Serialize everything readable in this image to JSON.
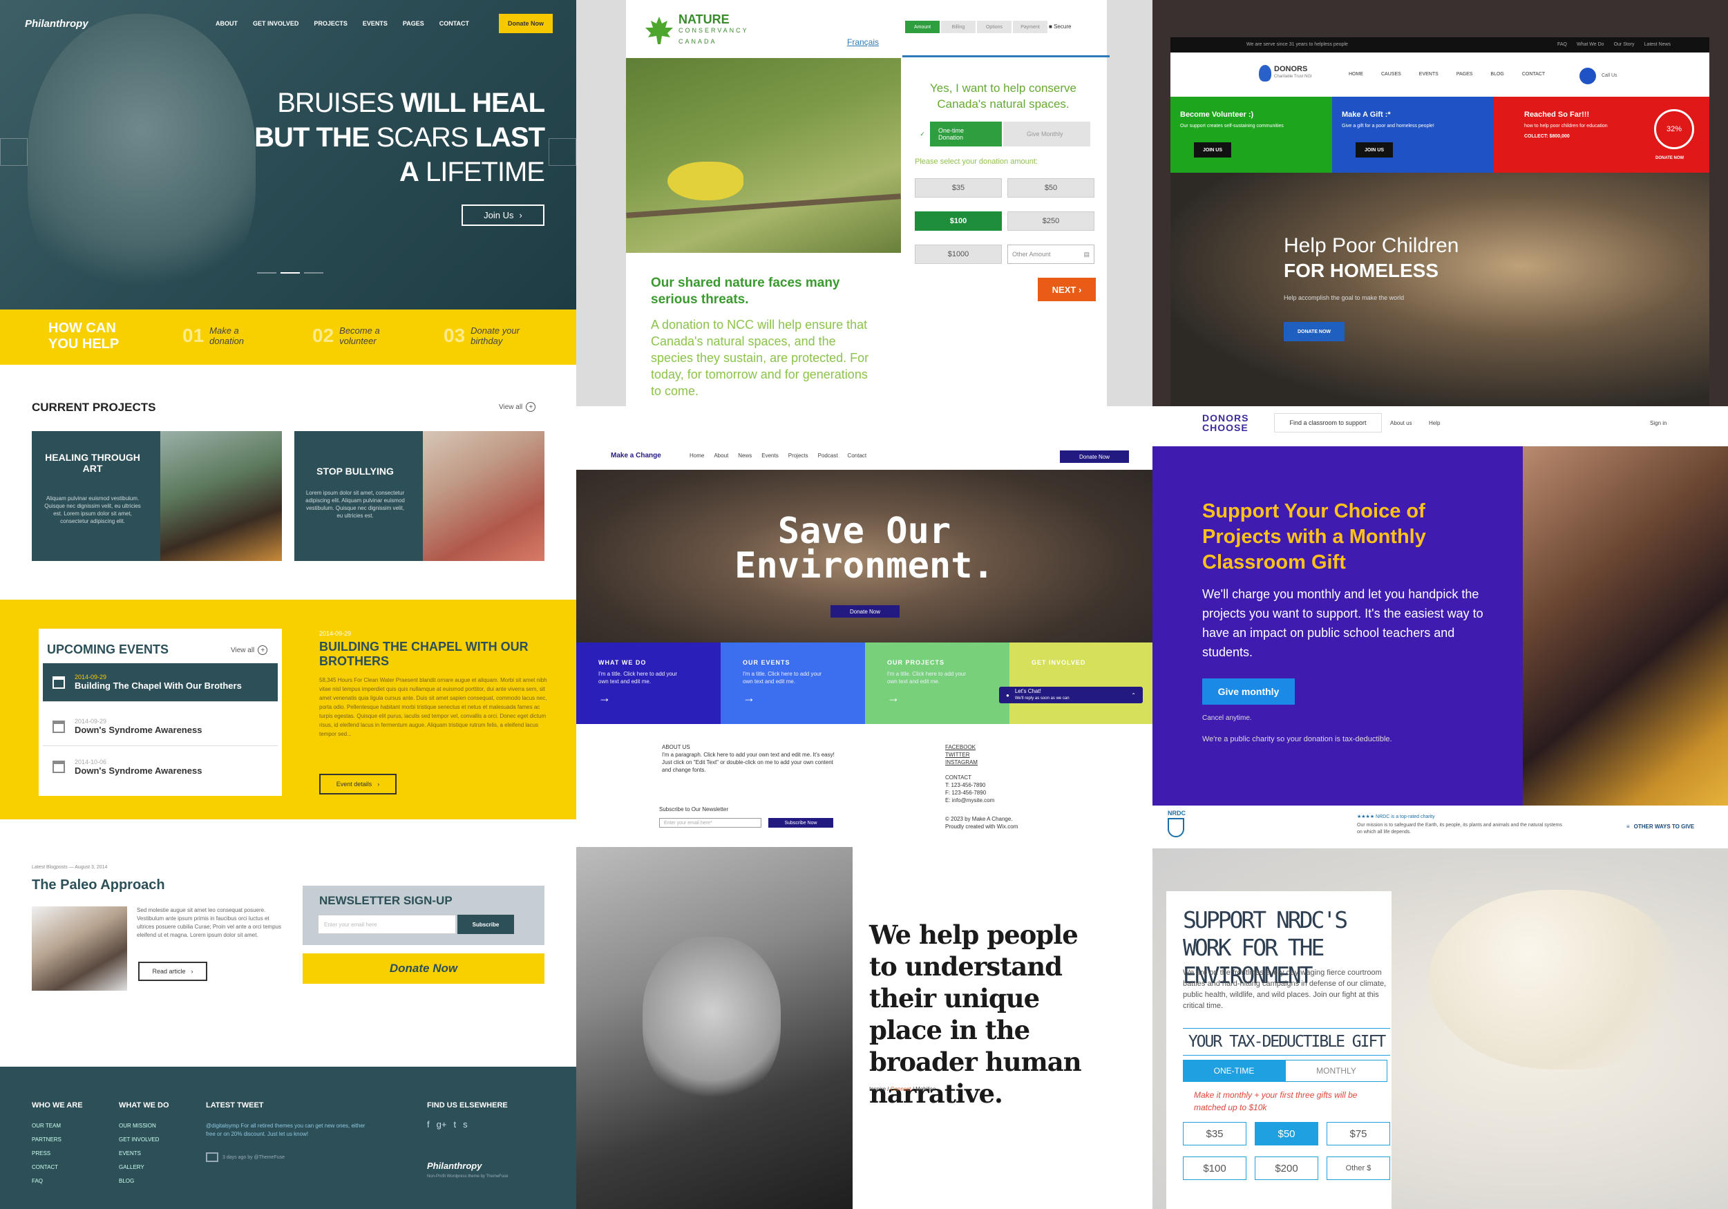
{
  "philanthropy": {
    "brand": "Philanthropy",
    "nav": [
      "ABOUT",
      "GET INVOLVED",
      "PROJECTS",
      "EVENTS",
      "PAGES",
      "CONTACT"
    ],
    "donate_now": "Donate Now",
    "headline": {
      "l1a": "BRUISES",
      "l1b": "WILL HEAL",
      "l2a": "BUT THE",
      "l2b": "SCARS",
      "l2c": "LAST",
      "l3a": "A",
      "l3b": "LIFETIME"
    },
    "join_us": "Join Us",
    "how_can": "HOW CAN YOU HELP",
    "steps": [
      {
        "num": "01",
        "label": "Make a donation"
      },
      {
        "num": "02",
        "label": "Become a volunteer"
      },
      {
        "num": "03",
        "label": "Donate your birthday"
      }
    ],
    "current_projects": "CURRENT PROJECTS",
    "view_all": "View all",
    "projects": [
      {
        "title": "HEALING THROUGH ART",
        "desc": "Aliquam pulvinar euismod vestibulum. Quisque nec dignissim velit, eu ultricies est. Lorem ipsum dolor sit amet, consectetur adipiscing elit."
      },
      {
        "title": "STOP BULLYING",
        "desc": "Lorem ipsum dolor sit amet, consectetur adipiscing elit. Aliquam pulvinar euismod vestibulum. Quisque nec dignissim velit, eu ultricies est."
      }
    ],
    "upcoming_events": "UPCOMING EVENTS",
    "events": [
      {
        "date": "2014-09-29",
        "name": "Building The Chapel With Our Brothers"
      },
      {
        "date": "2014-09-29",
        "name": "Down's Syndrome Awareness"
      },
      {
        "date": "2014-10-06",
        "name": "Down's Syndrome Awareness"
      }
    ],
    "article": {
      "date": "2014-09-29",
      "title": "BUILDING THE CHAPEL WITH OUR BROTHERS",
      "body": "58,345 Hours For Clean Water Praesent blandit ornare augue et aliquam. Morbi sit amet nibh vitae nisl tempus imperdiet quis quis nullamque at euismod porttitor, dui ante viverra sem, sit amet venenatis quia ligula cursus ante. Duis sit amet sapien consequat, commodo lacus nec, porta odio. Pellentesque habitant morbi tristique senectus et netus et malesuada fames ac turpis egestas. Quisque elit purus, iaculis sed tempor vel, convallis a orci. Donec eget dictum risus, id eleifend lacus in fermentum augue. Aliquam tristique rutrum felis, a eleifend lacus tempor sed...",
      "details": "Event details"
    },
    "blog": {
      "meta": "Latest Blogposts — August 3, 2014",
      "title": "The Paleo Approach",
      "body": "Sed molestie augue sit amet leo consequat posuere. Vestibulum ante ipsum primis in faucibus orci luctus et ultrices posuere cubilia Curae; Proin vel ante a orci tempus eleifend ut et magna. Lorem ipsum dolor sit amet.",
      "read": "Read article"
    },
    "newsletter": {
      "title": "NEWSLETTER SIGN-UP",
      "placeholder": "Enter your email here",
      "button": "Subscribe"
    },
    "donate_big": "Donate Now",
    "footer": {
      "who": "WHO WE ARE",
      "who_items": [
        "OUR TEAM",
        "PARTNERS",
        "PRESS",
        "CONTACT",
        "FAQ"
      ],
      "what": "WHAT WE DO",
      "what_items": [
        "OUR MISSION",
        "GET INVOLVED",
        "EVENTS",
        "GALLERY",
        "BLOG"
      ],
      "tweet": "LATEST TWEET",
      "tweet_text": "@digitalsymp For all retired themes you can get new ones, either free or on 20% discount. Just let us know!",
      "tweet_meta": "3 days ago by @ThemeFuse",
      "find": "FIND US ELSEWHERE",
      "brand": "Philanthropy",
      "credit": "Non-Profit Wordpress theme by ThemeFuse"
    }
  },
  "ncc": {
    "logo_top": "NATURE",
    "logo_mid": "CONSERVANCY",
    "logo_bot": "CANADA",
    "francais": "Français",
    "tabs": [
      "Amount",
      "Billing",
      "Options",
      "Payment"
    ],
    "secure": "Secure",
    "ask": "Yes, I want to help conserve Canada's natural spaces.",
    "one_time": "One-time Donation",
    "monthly": "Give Monthly",
    "select_label": "Please select your donation amount:",
    "amounts": [
      "$35",
      "$50",
      "$100",
      "$250",
      "$1000"
    ],
    "other": "Other Amount",
    "next": "NEXT",
    "threat": "Our shared nature faces many serious threats.",
    "para": "A donation to NCC will help ensure that Canada's natural spaces, and the species they sustain, are protected. For today, for tomorrow and for generations to come."
  },
  "donors": {
    "topbar": "We are serve since 31 years to helpless people",
    "toplinks": [
      "FAQ",
      "What We Do",
      "Our Story",
      "Latest News"
    ],
    "logo": "DONORS",
    "logo_sub": "Charitable Trust NGI",
    "nav": [
      "HOME",
      "CAUSES",
      "EVENTS",
      "PAGES",
      "BLOG",
      "CONTACT"
    ],
    "call": "Call Us",
    "boxes": [
      {
        "title": "Become Volunteer :)",
        "desc": "Our support creates self-sustaining communities",
        "btn": "JOIN US",
        "color": "#1ea51e"
      },
      {
        "title": "Make A Gift :*",
        "desc": "Give a gift for a poor and homeless people!",
        "btn": "JOIN US",
        "color": "#1f52c4"
      },
      {
        "title": "Reached So Far!!!",
        "desc": "how to help poor children for education",
        "collect": "COLLECT: $800,000",
        "pct": "32%",
        "btn": "DONATE NOW",
        "color": "#e01818"
      }
    ],
    "hero_title": "Help Poor Children",
    "hero_bold": "FOR HOMELESS",
    "hero_sub": "Help accomplish the goal to make the world",
    "donate": "DONATE NOW"
  },
  "make_change": {
    "brand": "Make a Change",
    "nav": [
      "Home",
      "About",
      "News",
      "Events",
      "Projects",
      "Podcast",
      "Contact"
    ],
    "donate_now": "Donate Now",
    "title_l1": "Save Our",
    "title_l2": "Environment.",
    "tiles": [
      {
        "title": "WHAT WE DO",
        "desc": "I'm a title. Click here to add your own text and edit me.",
        "color": "#2a1fb8"
      },
      {
        "title": "OUR EVENTS",
        "desc": "I'm a title. Click here to add your own text and edit me.",
        "color": "#3c6ef0"
      },
      {
        "title": "OUR PROJECTS",
        "desc": "I'm a title. Click here to add your own text and edit me.",
        "color": "#78d17a"
      },
      {
        "title": "GET INVOLVED",
        "desc": "",
        "color": "#d6e05a"
      }
    ],
    "chat": "Let's Chat!",
    "chat_sub": "We'll reply as soon as we can",
    "about_title": "ABOUT US",
    "about_text": "I'm a paragraph. Click here to add your own text and edit me. It's easy! Just click on \"Edit Text\" or double-click on me to add your own content and change fonts.",
    "social": [
      "FACEBOOK",
      "TWITTER",
      "INSTAGRAM"
    ],
    "contact_title": "CONTACT",
    "contact": [
      "T: 123-456-7890",
      "F: 123-456-7890",
      "E: info@mysite.com"
    ],
    "copyright": "© 2023 by Make A Change.",
    "proudly": "Proudly created with Wix.com",
    "subscribe_title": "Subscribe to Our Newsletter",
    "email_placeholder": "Enter your email here*",
    "subscribe_btn": "Subscribe Now"
  },
  "donorschoose": {
    "logo_l1": "DONORS",
    "logo_l2": "CHOOSE",
    "find": "Find a classroom to support",
    "about": "About us",
    "help": "Help",
    "signin": "Sign in",
    "headline": "Support Your Choice of Projects with a Monthly Classroom Gift",
    "para": "We'll charge you monthly and let you handpick the projects you want to support. It's the easiest way to have an impact on public school teachers and students.",
    "give_monthly": "Give monthly",
    "cancel": "Cancel anytime.",
    "public": "We're a public charity so your donation is tax-deductible."
  },
  "story": {
    "quote": "We help people to understand their unique place in the broader human narrative.",
    "crumb1": "Inspire",
    "crumb2": "Connect",
    "crumb3": "Mobilise"
  },
  "nrdc": {
    "logo": "NRDC",
    "rating": "★★★★ NRDC is a top-rated charity",
    "mission": "Our mission is to safeguard the Earth, its people, its plants and animals and the natural systems on which all life depends.",
    "other_ways": "OTHER WAYS TO GIVE",
    "headline": "SUPPORT NRDC'S WORK FOR THE ENVIRONMENT",
    "para": "We are on the frontlines every day waging fierce courtroom battles and hard-hitting campaigns in defense of our climate, public health, wildlife, and wild places. Join our fight at this critical time.",
    "gift": "YOUR TAX-DEDUCTIBLE GIFT",
    "one_time": "ONE-TIME",
    "monthly": "MONTHLY",
    "note": "Make it monthly + your first three gifts will be matched up to $10k",
    "amounts": [
      "$35",
      "$50",
      "$75",
      "$100",
      "$200",
      "Other $"
    ]
  }
}
